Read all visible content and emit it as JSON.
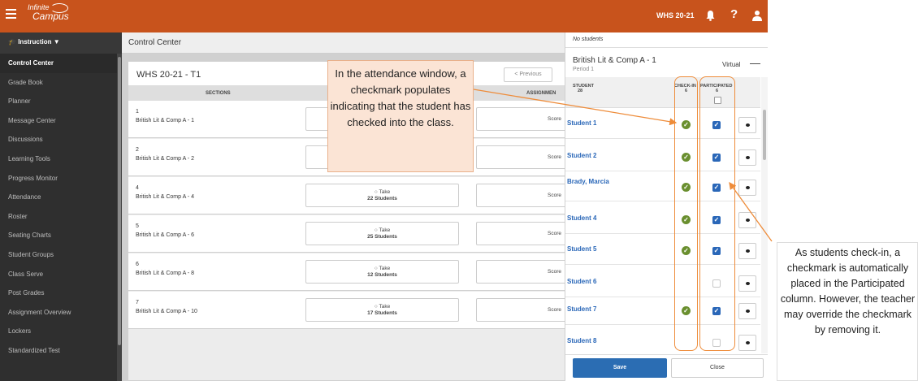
{
  "topbar": {
    "logo_line1": "Infinite",
    "logo_line2": "Campus",
    "year": "WHS 20-21",
    "bell_icon": "bell-icon",
    "help_icon": "help-icon",
    "user_icon": "user-icon"
  },
  "sidebar": {
    "header": "Instruction",
    "items": [
      "Control Center",
      "Grade Book",
      "Planner",
      "Message Center",
      "Discussions",
      "Learning Tools",
      "Progress Monitor",
      "Attendance",
      "Roster",
      "Seating Charts",
      "Student Groups",
      "Class Serve",
      "Post Grades",
      "Assignment Overview",
      "Lockers",
      "Standardized Test"
    ]
  },
  "main": {
    "title": "Control Center",
    "panel_title": "WHS 20-21 - T1",
    "previous_label": "< Previous",
    "col_sections": "SECTIONS",
    "col_assignments": "ASSIGNMEN",
    "score_label": "Score",
    "take_label": "Take",
    "rows": [
      {
        "num": "1",
        "name": "British Lit & Comp A - 1",
        "students": ""
      },
      {
        "num": "2",
        "name": "British Lit & Comp A - 2",
        "students": ""
      },
      {
        "num": "4",
        "name": "British Lit & Comp A - 4",
        "students": "22 Students"
      },
      {
        "num": "5",
        "name": "British Lit & Comp A - 6",
        "students": "25 Students"
      },
      {
        "num": "6",
        "name": "British Lit & Comp A - 8",
        "students": "12 Students"
      },
      {
        "num": "7",
        "name": "British Lit & Comp A - 10",
        "students": "17 Students"
      }
    ]
  },
  "attendance": {
    "no_students": "No students",
    "class_name": "British Lit & Comp A - 1",
    "period": "Period 1",
    "mode": "Virtual",
    "col_student": "STUDENT",
    "student_count": "28",
    "col_checkin": "CHECK-IN",
    "checkin_count": "6",
    "col_participated": "PARTICIPATED",
    "participated_count": "6",
    "students": [
      {
        "name": "Student 1",
        "checked_in": true,
        "participated": true
      },
      {
        "name": "Student 2",
        "checked_in": true,
        "participated": true
      },
      {
        "name": "Brady, Marcia",
        "checked_in": true,
        "participated": true
      },
      {
        "name": "Student 4",
        "checked_in": true,
        "participated": true
      },
      {
        "name": "Student 5",
        "checked_in": true,
        "participated": true
      },
      {
        "name": "Student 6",
        "checked_in": false,
        "participated": false
      },
      {
        "name": "Student 7",
        "checked_in": true,
        "participated": true
      },
      {
        "name": "Student 8",
        "checked_in": false,
        "participated": false
      }
    ],
    "save_label": "Save",
    "close_label": "Close"
  },
  "callouts": {
    "left": "In the attendance window, a checkmark populates indicating that the student has checked into the class.",
    "right": "As students check-in, a checkmark is automatically placed in the Participated column.  However, the teacher may override the checkmark by removing it."
  },
  "colors": {
    "topbar": "#c8531c",
    "sidebar": "#2f2f2f",
    "link": "#2a67b8",
    "checkin_green": "#6a8f2f",
    "highlight_orange": "#ee8c3a",
    "callout_fill": "#fbe4d5"
  }
}
